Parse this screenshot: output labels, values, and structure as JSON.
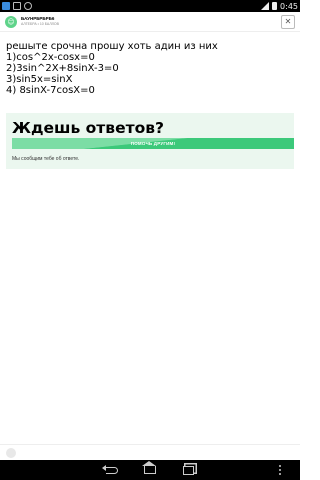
{
  "status_bar": {
    "time": "0:45",
    "icons": [
      "notification-icon",
      "photo-icon",
      "sync-icon",
      "signal-icon",
      "battery-icon"
    ]
  },
  "header": {
    "user_name": "БАУНРБРБРБ6",
    "user_meta": "АЛГЕБРА • 10 БАЛЛОВ",
    "avatar_icon": "user-avatar-icon",
    "close_icon": "close-icon"
  },
  "question": {
    "lines": [
      "решыте срочна прошу хоть адин из них",
      "1)cos^2x-cosx=0",
      "2)3sin^2X+8sinX-3=0",
      "3)sin5x=sinX",
      "4) 8sinX-7cosX=0"
    ]
  },
  "waiting_card": {
    "title": "Ждешь ответов?",
    "help_button_label": "ПОМОЧЬ ДРУГИМ!",
    "notify_text": "Мы сообщим тебе об ответе."
  },
  "colors": {
    "accent_green": "#3cc97a",
    "card_background": "#ebf7ef"
  },
  "nav_bar": {
    "icons": [
      "back-icon",
      "home-icon",
      "recent-apps-icon",
      "menu-icon"
    ]
  }
}
